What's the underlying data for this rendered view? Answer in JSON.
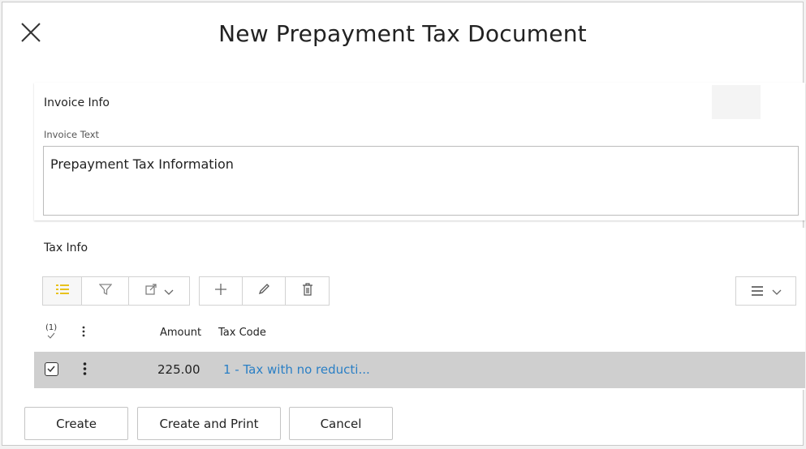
{
  "dialog": {
    "title": "New Prepayment Tax Document",
    "close_icon": "close-icon"
  },
  "invoice_info": {
    "section_title": "Invoice Info",
    "field_label": "Invoice Text",
    "field_value": "Prepayment Tax Information"
  },
  "tax_info": {
    "section_title": "Tax Info",
    "toolbar": {
      "icons": [
        "list-view-icon",
        "filter-icon",
        "export-icon",
        "chevron-down-icon",
        "add-icon",
        "edit-icon",
        "delete-icon",
        "menu-icon",
        "chevron-down-icon"
      ]
    },
    "selection_count": "(1)",
    "columns": [
      "Amount",
      "Tax Code"
    ],
    "rows": [
      {
        "amount": "225.00",
        "tax_code": "1 - Tax with no reducti..."
      }
    ]
  },
  "footer": {
    "create_label": "Create",
    "create_print_label": "Create and Print",
    "cancel_label": "Cancel"
  },
  "colors": {
    "link": "#2a7fc5",
    "selected_row": "#cfcfcf",
    "accent_yellow": "#e8c21c"
  }
}
